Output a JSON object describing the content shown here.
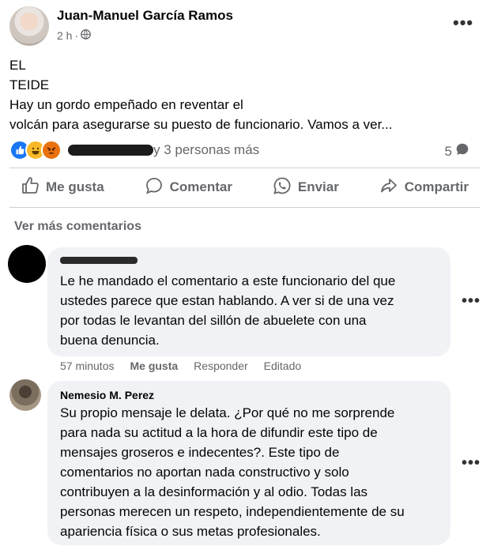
{
  "post": {
    "author": "Juan-Manuel García Ramos",
    "time": "2 h",
    "separator": "·",
    "privacy_icon": "globe-icon",
    "more_icon": "more-horizontal-icon",
    "lines": [
      "EL",
      "TEIDE",
      "Hay un gordo empeñado en reventar el",
      "volcán para asegurarse su puesto de funcionario. Vamos a ver..."
    ],
    "reactions": {
      "icons": [
        "like-reaction-icon",
        "haha-reaction-icon",
        "angry-reaction-icon"
      ],
      "others_text": "y 3 personas más"
    },
    "comment_count": "5",
    "comment_count_icon": "comment-bubble-icon"
  },
  "actions": {
    "like": "Me gusta",
    "comment": "Comentar",
    "send": "Enviar",
    "share": "Compartir"
  },
  "see_more_comments": "Ver más comentarios",
  "comments": [
    {
      "author": "",
      "lines": [
        "Le he mandado el comentario a este funcionario del que",
        "ustedes parece que estan hablando. A ver si de una vez",
        "por todas le levantan del sillón de abuelete con una",
        "buena denuncia."
      ],
      "time": "57 minutos",
      "like": "Me gusta",
      "reply": "Responder",
      "edited": "Editado"
    },
    {
      "author": "Nemesio M. Perez",
      "lines": [
        "Su propio mensaje le delata. ¿Por qué no me sorprende",
        "para nada su actitud a la hora de difundir este tipo de",
        "mensajes groseros e indecentes?. Este tipo de",
        "comentarios no aportan nada constructivo y solo",
        "contribuyen a la desinformación y al odio. Todas las",
        "personas merecen un respeto, independientemente de su",
        "apariencia física o sus metas profesionales."
      ]
    }
  ],
  "colors": {
    "text": "#050505",
    "secondary": "#65676b",
    "bubble": "#f0f2f5",
    "like_blue": "#1877f2",
    "haha_yellow": "#f7b928",
    "angry_orange": "#e9710f",
    "divider": "#ced0d4"
  }
}
